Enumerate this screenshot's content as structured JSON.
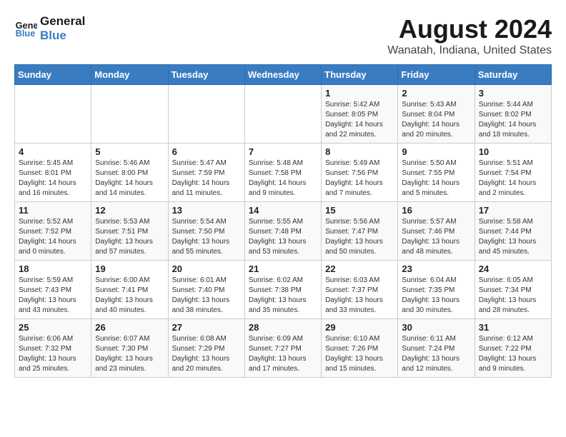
{
  "logo": {
    "line1": "General",
    "line2": "Blue"
  },
  "title": "August 2024",
  "location": "Wanatah, Indiana, United States",
  "days_of_week": [
    "Sunday",
    "Monday",
    "Tuesday",
    "Wednesday",
    "Thursday",
    "Friday",
    "Saturday"
  ],
  "weeks": [
    [
      {
        "day": "",
        "info": ""
      },
      {
        "day": "",
        "info": ""
      },
      {
        "day": "",
        "info": ""
      },
      {
        "day": "",
        "info": ""
      },
      {
        "day": "1",
        "info": "Sunrise: 5:42 AM\nSunset: 8:05 PM\nDaylight: 14 hours\nand 22 minutes."
      },
      {
        "day": "2",
        "info": "Sunrise: 5:43 AM\nSunset: 8:04 PM\nDaylight: 14 hours\nand 20 minutes."
      },
      {
        "day": "3",
        "info": "Sunrise: 5:44 AM\nSunset: 8:02 PM\nDaylight: 14 hours\nand 18 minutes."
      }
    ],
    [
      {
        "day": "4",
        "info": "Sunrise: 5:45 AM\nSunset: 8:01 PM\nDaylight: 14 hours\nand 16 minutes."
      },
      {
        "day": "5",
        "info": "Sunrise: 5:46 AM\nSunset: 8:00 PM\nDaylight: 14 hours\nand 14 minutes."
      },
      {
        "day": "6",
        "info": "Sunrise: 5:47 AM\nSunset: 7:59 PM\nDaylight: 14 hours\nand 11 minutes."
      },
      {
        "day": "7",
        "info": "Sunrise: 5:48 AM\nSunset: 7:58 PM\nDaylight: 14 hours\nand 9 minutes."
      },
      {
        "day": "8",
        "info": "Sunrise: 5:49 AM\nSunset: 7:56 PM\nDaylight: 14 hours\nand 7 minutes."
      },
      {
        "day": "9",
        "info": "Sunrise: 5:50 AM\nSunset: 7:55 PM\nDaylight: 14 hours\nand 5 minutes."
      },
      {
        "day": "10",
        "info": "Sunrise: 5:51 AM\nSunset: 7:54 PM\nDaylight: 14 hours\nand 2 minutes."
      }
    ],
    [
      {
        "day": "11",
        "info": "Sunrise: 5:52 AM\nSunset: 7:52 PM\nDaylight: 14 hours\nand 0 minutes."
      },
      {
        "day": "12",
        "info": "Sunrise: 5:53 AM\nSunset: 7:51 PM\nDaylight: 13 hours\nand 57 minutes."
      },
      {
        "day": "13",
        "info": "Sunrise: 5:54 AM\nSunset: 7:50 PM\nDaylight: 13 hours\nand 55 minutes."
      },
      {
        "day": "14",
        "info": "Sunrise: 5:55 AM\nSunset: 7:48 PM\nDaylight: 13 hours\nand 53 minutes."
      },
      {
        "day": "15",
        "info": "Sunrise: 5:56 AM\nSunset: 7:47 PM\nDaylight: 13 hours\nand 50 minutes."
      },
      {
        "day": "16",
        "info": "Sunrise: 5:57 AM\nSunset: 7:46 PM\nDaylight: 13 hours\nand 48 minutes."
      },
      {
        "day": "17",
        "info": "Sunrise: 5:58 AM\nSunset: 7:44 PM\nDaylight: 13 hours\nand 45 minutes."
      }
    ],
    [
      {
        "day": "18",
        "info": "Sunrise: 5:59 AM\nSunset: 7:43 PM\nDaylight: 13 hours\nand 43 minutes."
      },
      {
        "day": "19",
        "info": "Sunrise: 6:00 AM\nSunset: 7:41 PM\nDaylight: 13 hours\nand 40 minutes."
      },
      {
        "day": "20",
        "info": "Sunrise: 6:01 AM\nSunset: 7:40 PM\nDaylight: 13 hours\nand 38 minutes."
      },
      {
        "day": "21",
        "info": "Sunrise: 6:02 AM\nSunset: 7:38 PM\nDaylight: 13 hours\nand 35 minutes."
      },
      {
        "day": "22",
        "info": "Sunrise: 6:03 AM\nSunset: 7:37 PM\nDaylight: 13 hours\nand 33 minutes."
      },
      {
        "day": "23",
        "info": "Sunrise: 6:04 AM\nSunset: 7:35 PM\nDaylight: 13 hours\nand 30 minutes."
      },
      {
        "day": "24",
        "info": "Sunrise: 6:05 AM\nSunset: 7:34 PM\nDaylight: 13 hours\nand 28 minutes."
      }
    ],
    [
      {
        "day": "25",
        "info": "Sunrise: 6:06 AM\nSunset: 7:32 PM\nDaylight: 13 hours\nand 25 minutes."
      },
      {
        "day": "26",
        "info": "Sunrise: 6:07 AM\nSunset: 7:30 PM\nDaylight: 13 hours\nand 23 minutes."
      },
      {
        "day": "27",
        "info": "Sunrise: 6:08 AM\nSunset: 7:29 PM\nDaylight: 13 hours\nand 20 minutes."
      },
      {
        "day": "28",
        "info": "Sunrise: 6:09 AM\nSunset: 7:27 PM\nDaylight: 13 hours\nand 17 minutes."
      },
      {
        "day": "29",
        "info": "Sunrise: 6:10 AM\nSunset: 7:26 PM\nDaylight: 13 hours\nand 15 minutes."
      },
      {
        "day": "30",
        "info": "Sunrise: 6:11 AM\nSunset: 7:24 PM\nDaylight: 13 hours\nand 12 minutes."
      },
      {
        "day": "31",
        "info": "Sunrise: 6:12 AM\nSunset: 7:22 PM\nDaylight: 13 hours\nand 9 minutes."
      }
    ]
  ]
}
